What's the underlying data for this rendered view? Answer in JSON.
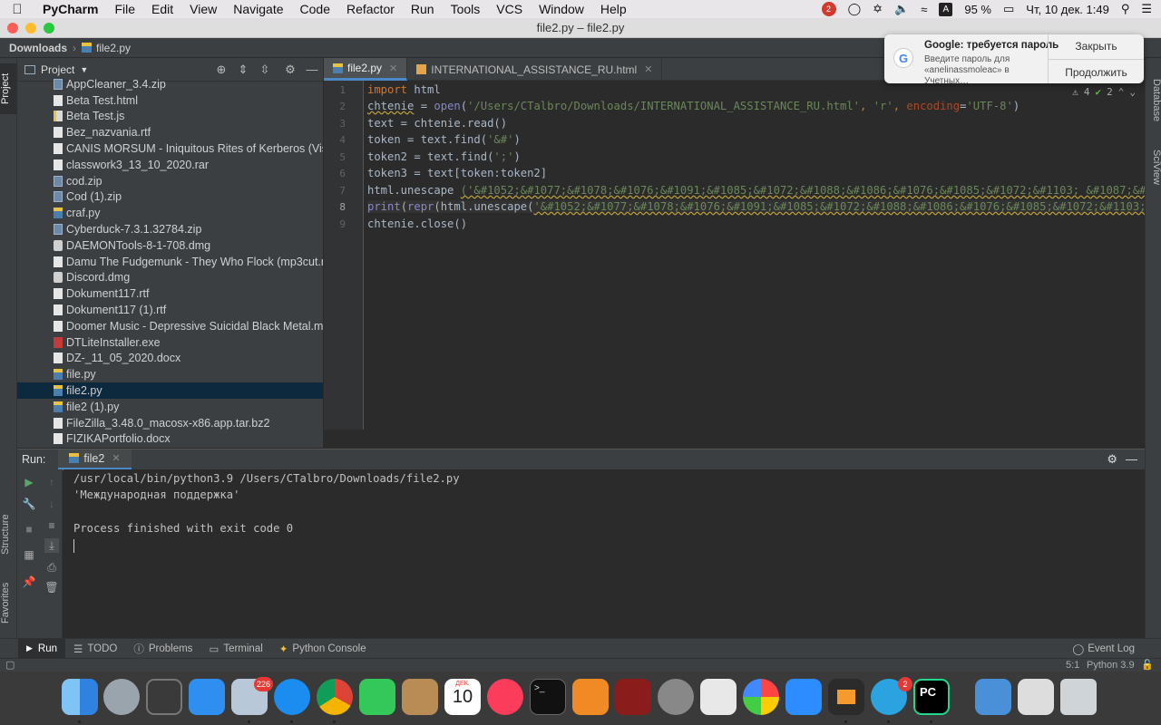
{
  "menubar": {
    "apple": "",
    "items": [
      "PyCharm",
      "File",
      "Edit",
      "View",
      "Navigate",
      "Code",
      "Refactor",
      "Run",
      "Tools",
      "VCS",
      "Window",
      "Help"
    ],
    "notif_badge": "2",
    "input_source": "A",
    "battery": "95 %",
    "datetime": "Чт, 10 дек.  1:49"
  },
  "window": {
    "title": "file2.py – file2.py"
  },
  "navbar": {
    "crumb1": "Downloads",
    "crumb2": "file2.py"
  },
  "leftstrip": {
    "project": "Project",
    "structure": "Structure",
    "favorites": "Favorites"
  },
  "rightstrip": {
    "database": "Database",
    "sciview": "SciView"
  },
  "project": {
    "title": "Project",
    "files": [
      {
        "name": "AppCleaner_3.4.zip",
        "type": "zip"
      },
      {
        "name": "Beta Test.html",
        "type": "doc"
      },
      {
        "name": "Beta Test.js",
        "type": "js"
      },
      {
        "name": "Bez_nazvania.rtf",
        "type": "doc"
      },
      {
        "name": "CANIS MORSUM - Iniquitous Rites of Kerberos (Visu",
        "type": "doc"
      },
      {
        "name": "classwork3_13_10_2020.rar",
        "type": "doc"
      },
      {
        "name": "cod.zip",
        "type": "zip"
      },
      {
        "name": "Cod (1).zip",
        "type": "zip"
      },
      {
        "name": "craf.py",
        "type": "py"
      },
      {
        "name": "Cyberduck-7.3.1.32784.zip",
        "type": "zip"
      },
      {
        "name": "DAEMONTools-8-1-708.dmg",
        "type": "dmg"
      },
      {
        "name": "Damu The Fudgemunk - They Who Flock (mp3cut.n",
        "type": "doc"
      },
      {
        "name": "Discord.dmg",
        "type": "dmg"
      },
      {
        "name": "Dokument117.rtf",
        "type": "doc"
      },
      {
        "name": "Dokument117 (1).rtf",
        "type": "doc"
      },
      {
        "name": "Doomer Music - Depressive Suicidal Black Metal.mp",
        "type": "doc"
      },
      {
        "name": "DTLiteInstaller.exe",
        "type": "red"
      },
      {
        "name": "DZ-_11_05_2020.docx",
        "type": "doc"
      },
      {
        "name": "file.py",
        "type": "py"
      },
      {
        "name": "file2.py",
        "type": "py",
        "selected": true
      },
      {
        "name": "file2 (1).py",
        "type": "py"
      },
      {
        "name": "FileZilla_3.48.0_macosx-x86.app.tar.bz2",
        "type": "doc"
      },
      {
        "name": "FIZIKAPortfolio.docx",
        "type": "doc"
      }
    ]
  },
  "editor": {
    "tabs": [
      {
        "label": "file2.py",
        "active": true
      },
      {
        "label": "INTERNATIONAL_ASSISTANCE_RU.html",
        "active": false
      }
    ],
    "warnings": "4",
    "checks": "2",
    "code": {
      "l1_kw": "import",
      "l1_mod": " html",
      "l2_var": "chtenie",
      "l2_eq": " = ",
      "l2_fn": "open",
      "l2_p1": "(",
      "l2_s1": "'/Users/CTalbro/Downloads/INTERNATIONAL_ASSISTANCE_RU.html'",
      "l2_c1": ", ",
      "l2_s2": "'r'",
      "l2_c2": ", ",
      "l2_param": "encoding",
      "l2_eq2": "=",
      "l2_s3": "'UTF-8'",
      "l2_p2": ")",
      "l3": "text = chtenie.read()",
      "l4_a": "token = text.find(",
      "l4_s": "'&#'",
      "l4_b": ")",
      "l5_a": "token2 = text.find(",
      "l5_s": "';'",
      "l5_b": ")",
      "l6": "token3 = text[token:token2]",
      "l7_a": "html.unescape ",
      "l7_s": "('&#1052;&#1077;&#1078;&#1076;&#1091;&#1085;&#1072;&#1088;&#1086;&#1076;&#1085;&#1072;&#1103; &#1087;&#1086;",
      "l8_fn": "print",
      "l8_p": "(",
      "l8_fn2": "repr",
      "l8_a": "(html.unescape(",
      "l8_s": "'&#1052;&#1077;&#1078;&#1076;&#1091;&#1085;&#1072;&#1088;&#1086;&#1076;&#1085;&#1072;&#1103; &#1087;",
      "l9": "chtenie.close()"
    }
  },
  "notification": {
    "title": "Google: требуется пароль",
    "body": "Введите пароль для «anelinassmoleac» в Учетных…",
    "close": "Закрыть",
    "continue": "Продолжить"
  },
  "run": {
    "label": "Run:",
    "tab": "file2",
    "output": [
      "/usr/local/bin/python3.9 /Users/CTalbro/Downloads/file2.py",
      "'Международная поддержка'",
      "",
      "Process finished with exit code 0"
    ]
  },
  "bottomtabs": {
    "run": "Run",
    "todo": "TODO",
    "problems": "Problems",
    "terminal": "Terminal",
    "console": "Python Console",
    "eventlog": "Event Log"
  },
  "statusbar": {
    "position": "5:1",
    "interpreter": "Python 3.9"
  },
  "dock": {
    "mail_badge": "226",
    "calendar_month": "ДЕК.",
    "calendar_day": "10",
    "telegram_badge": "2"
  }
}
